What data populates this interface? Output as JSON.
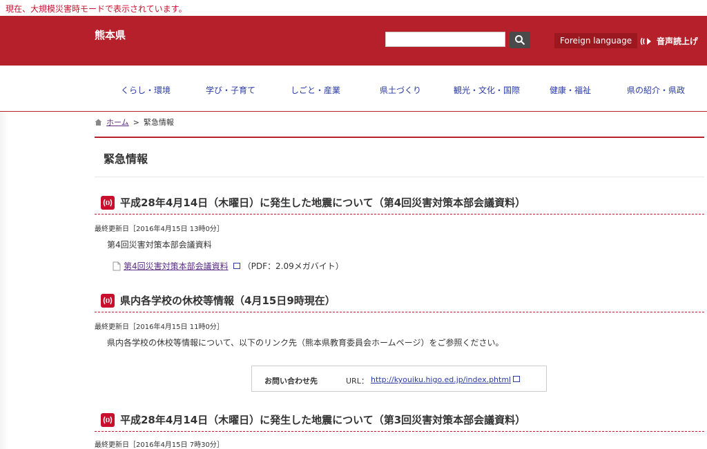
{
  "banner": "現在、大規模災害時モードで表示されています。",
  "header": {
    "logo": "熊本県",
    "search_placeholder": "",
    "foreign_language": "Foreign language",
    "voice": "音声読上げ"
  },
  "nav": [
    "くらし・環境",
    "学び・子育て",
    "しごと・産業",
    "県土づくり",
    "観光・文化・国際",
    "健康・福祉",
    "県の紹介・県政"
  ],
  "breadcrumb": {
    "home": "ホーム",
    "separator": ">",
    "current": "緊急情報"
  },
  "page_title": "緊急情報",
  "sections": [
    {
      "title": "平成28年4月14日（木曜日）に発生した地震について（第4回災害対策本部会議資料）",
      "updated": "最終更新日［2016年4月15日 13時0分］",
      "text": "第4回災害対策本部会議資料",
      "pdf_link": "第4回災害対策本部会議資料",
      "pdf_info": "（PDF：2.09メガバイト）"
    },
    {
      "title": "県内各学校の休校等情報（4月15日9時現在）",
      "updated": "最終更新日［2016年4月15日 11時0分］",
      "text": "県内各学校の休校等情報について、以下のリンク先（熊本県教育委員会ホームページ）をご参照ください。",
      "contact_label": "お問い合わせ先",
      "url_label": "URL：",
      "url": "http://kyouiku.higo.ed.jp/index.phtml"
    },
    {
      "title": "平成28年4月14日（木曜日）に発生した地震について（第3回災害対策本部会議資料）",
      "updated": "最終更新日［2016年4月15日 7時30分］"
    }
  ]
}
